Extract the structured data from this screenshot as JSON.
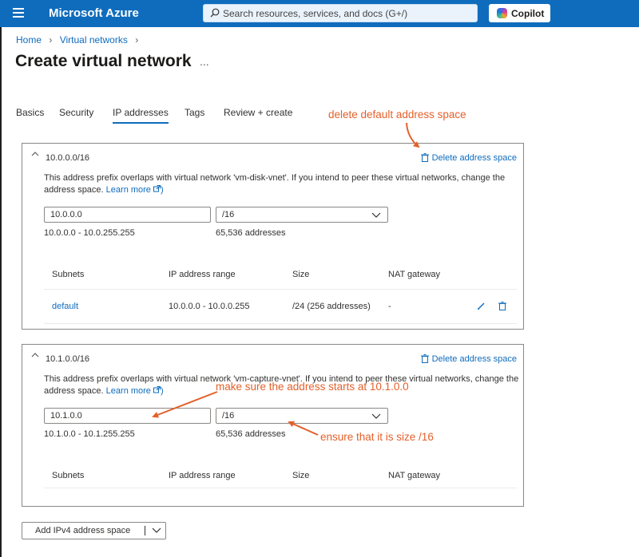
{
  "topbar": {
    "brand": "Microsoft Azure",
    "search_placeholder": "Search resources, services, and docs (G+/)",
    "copilot_label": "Copilot",
    "bg_color": "#0f6cbd"
  },
  "breadcrumb": [
    "Home",
    "Virtual networks"
  ],
  "page": {
    "title": "Create virtual network",
    "more": "..."
  },
  "tabs": [
    "Basics",
    "Security",
    "IP addresses",
    "Tags",
    "Review + create"
  ],
  "active_tab": "IP addresses",
  "spaces": [
    {
      "prefix": "10.0.0.0/16",
      "delete_label": "Delete address space",
      "warning": "This address prefix overlaps with virtual network 'vm-disk-vnet'. If you intend to peer these virtual networks, change the address space.",
      "learn_more": "Learn more",
      "address": "10.0.0.0",
      "size": "/16",
      "range": "10.0.0.0 - 10.0.255.255",
      "count": "65,536 addresses",
      "headers": [
        "Subnets",
        "IP address range",
        "Size",
        "NAT gateway"
      ],
      "subnets": [
        {
          "name": "default",
          "range": "10.0.0.0 - 10.0.0.255",
          "size": "/24 (256 addresses)",
          "nat": "-"
        }
      ]
    },
    {
      "prefix": "10.1.0.0/16",
      "delete_label": "Delete address space",
      "warning": "This address prefix overlaps with virtual network 'vm-capture-vnet'. If you intend to peer these virtual networks, change the address space.",
      "learn_more": "Learn more",
      "address": "10.1.0.0",
      "size": "/16",
      "range": "10.1.0.0 - 10.1.255.255",
      "count": "65,536 addresses",
      "headers": [
        "Subnets",
        "IP address range",
        "Size",
        "NAT gateway"
      ],
      "subnets": []
    }
  ],
  "add_button": "Add IPv4 address space",
  "annotations": {
    "delete_note": "delete default address space",
    "address_note": "make sure the address starts at 10.1.0.0",
    "size_note": "ensure that it is size /16",
    "color": "#e4602a"
  }
}
